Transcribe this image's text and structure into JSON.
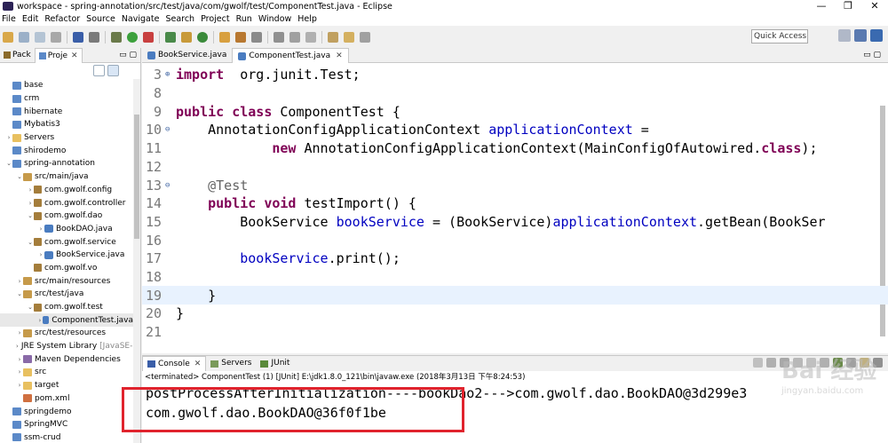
{
  "window": {
    "title": "workspace - spring-annotation/src/test/java/com/gwolf/test/ComponentTest.java - Eclipse",
    "controls": [
      "—",
      "❐",
      "✕"
    ]
  },
  "menu": [
    "File",
    "Edit",
    "Refactor",
    "Source",
    "Navigate",
    "Search",
    "Project",
    "Run",
    "Window",
    "Help"
  ],
  "toolbar": {
    "quick_access_placeholder": "Quick Access"
  },
  "explorer": {
    "tabs": [
      {
        "label": "Pack"
      },
      {
        "label": "Proje",
        "close": "✕"
      }
    ],
    "tree": [
      {
        "indent": 0,
        "arrow": "",
        "icon": "proj",
        "label": "base"
      },
      {
        "indent": 0,
        "arrow": "",
        "icon": "proj",
        "label": "crm"
      },
      {
        "indent": 0,
        "arrow": "",
        "icon": "proj",
        "label": "hibernate"
      },
      {
        "indent": 0,
        "arrow": "",
        "icon": "proj",
        "label": "Mybatis3"
      },
      {
        "indent": 0,
        "arrow": "›",
        "icon": "fold",
        "label": "Servers"
      },
      {
        "indent": 0,
        "arrow": "",
        "icon": "proj",
        "label": "shirodemo"
      },
      {
        "indent": 0,
        "arrow": "⌄",
        "icon": "proj",
        "label": "spring-annotation"
      },
      {
        "indent": 1,
        "arrow": "⌄",
        "icon": "srcf",
        "label": "src/main/java"
      },
      {
        "indent": 2,
        "arrow": "›",
        "icon": "pkg",
        "label": "com.gwolf.config"
      },
      {
        "indent": 2,
        "arrow": "›",
        "icon": "pkg",
        "label": "com.gwolf.controller"
      },
      {
        "indent": 2,
        "arrow": "⌄",
        "icon": "pkg",
        "label": "com.gwolf.dao"
      },
      {
        "indent": 3,
        "arrow": "›",
        "icon": "java",
        "label": "BookDAO.java"
      },
      {
        "indent": 2,
        "arrow": "⌄",
        "icon": "pkg",
        "label": "com.gwolf.service"
      },
      {
        "indent": 3,
        "arrow": "›",
        "icon": "java",
        "label": "BookService.java"
      },
      {
        "indent": 2,
        "arrow": "",
        "icon": "pkg",
        "label": "com.gwolf.vo"
      },
      {
        "indent": 1,
        "arrow": "›",
        "icon": "srcf",
        "label": "src/main/resources"
      },
      {
        "indent": 1,
        "arrow": "⌄",
        "icon": "srcf",
        "label": "src/test/java"
      },
      {
        "indent": 2,
        "arrow": "⌄",
        "icon": "pkg",
        "label": "com.gwolf.test"
      },
      {
        "indent": 3,
        "arrow": "›",
        "icon": "java",
        "label": "ComponentTest.java",
        "selected": true
      },
      {
        "indent": 1,
        "arrow": "›",
        "icon": "srcf",
        "label": "src/test/resources"
      },
      {
        "indent": 1,
        "arrow": "›",
        "icon": "lib",
        "label": "JRE System Library",
        "annotation": "[JavaSE-1.8]"
      },
      {
        "indent": 1,
        "arrow": "›",
        "icon": "lib",
        "label": "Maven Dependencies"
      },
      {
        "indent": 1,
        "arrow": "›",
        "icon": "fold",
        "label": "src"
      },
      {
        "indent": 1,
        "arrow": "›",
        "icon": "fold",
        "label": "target"
      },
      {
        "indent": 1,
        "arrow": "",
        "icon": "xml",
        "label": "pom.xml"
      },
      {
        "indent": 0,
        "arrow": "",
        "icon": "proj",
        "label": "springdemo"
      },
      {
        "indent": 0,
        "arrow": "",
        "icon": "proj",
        "label": "SpringMVC"
      },
      {
        "indent": 0,
        "arrow": "",
        "icon": "proj",
        "label": "ssm-crud"
      }
    ]
  },
  "editor": {
    "tabs": [
      {
        "label": "BookService.java",
        "active": false
      },
      {
        "label": "ComponentTest.java",
        "active": true,
        "close": "✕"
      }
    ],
    "lines": [
      {
        "num": "3",
        "fold": "⊕",
        "tokens": [
          [
            "kw",
            "import"
          ],
          [
            "",
            "  org.junit.Test;"
          ]
        ]
      },
      {
        "num": "8",
        "tokens": []
      },
      {
        "num": "9",
        "tokens": [
          [
            "kw",
            "public class"
          ],
          [
            "",
            " ComponentTest {"
          ]
        ]
      },
      {
        "num": "10",
        "fold": "⊖",
        "tokens": [
          [
            "",
            "    AnnotationConfigApplicationContext "
          ],
          [
            "fld",
            "applicationContext"
          ],
          [
            "",
            " ="
          ]
        ]
      },
      {
        "num": "11",
        "tokens": [
          [
            "",
            "            "
          ],
          [
            "kw",
            "new"
          ],
          [
            "",
            " AnnotationConfigApplicationContext(MainConfigOfAutowired."
          ],
          [
            "kw",
            "class"
          ],
          [
            "",
            ");"
          ]
        ]
      },
      {
        "num": "12",
        "tokens": []
      },
      {
        "num": "13",
        "fold": "⊖",
        "tokens": [
          [
            "ann2",
            "    @Test"
          ]
        ]
      },
      {
        "num": "14",
        "tokens": [
          [
            "",
            "    "
          ],
          [
            "kw",
            "public void"
          ],
          [
            "",
            " testImport() {"
          ]
        ]
      },
      {
        "num": "15",
        "tokens": [
          [
            "",
            "        BookService "
          ],
          [
            "fld",
            "bookService"
          ],
          [
            "",
            " = (BookService)"
          ],
          [
            "fld",
            "applicationContext"
          ],
          [
            "",
            ".getBean(BookSer"
          ]
        ]
      },
      {
        "num": "16",
        "tokens": []
      },
      {
        "num": "17",
        "tokens": [
          [
            "",
            "        "
          ],
          [
            "fld",
            "bookService"
          ],
          [
            "",
            ".print();"
          ]
        ]
      },
      {
        "num": "18",
        "tokens": []
      },
      {
        "num": "19",
        "current": true,
        "tokens": [
          [
            "",
            "    }"
          ]
        ]
      },
      {
        "num": "20",
        "tokens": [
          [
            "",
            "}"
          ]
        ]
      },
      {
        "num": "21",
        "tokens": []
      }
    ]
  },
  "console": {
    "tabs": [
      {
        "label": "Console",
        "close": "✕",
        "active": true
      },
      {
        "label": "Servers"
      },
      {
        "label": "JUnit"
      }
    ],
    "status": "<terminated> ComponentTest (1) [JUnit] E:\\jdk1.8.0_121\\bin\\javaw.exe (2018年3月13日 下午8:24:53)",
    "output": [
      "postProcessAfterInitialization----bookDao2--->com.gwolf.dao.BookDAO@3d299e3",
      "com.gwolf.dao.BookDAO@36f0f1be"
    ]
  },
  "watermark": {
    "main": "Bai 经验",
    "url": "jingyan.baidu.com"
  },
  "colors": {
    "keyword": "#7f0055",
    "field": "#0000c0",
    "annotation": "#646464",
    "highlight_box": "#e0232d",
    "current_line": "#e8f2fe"
  }
}
